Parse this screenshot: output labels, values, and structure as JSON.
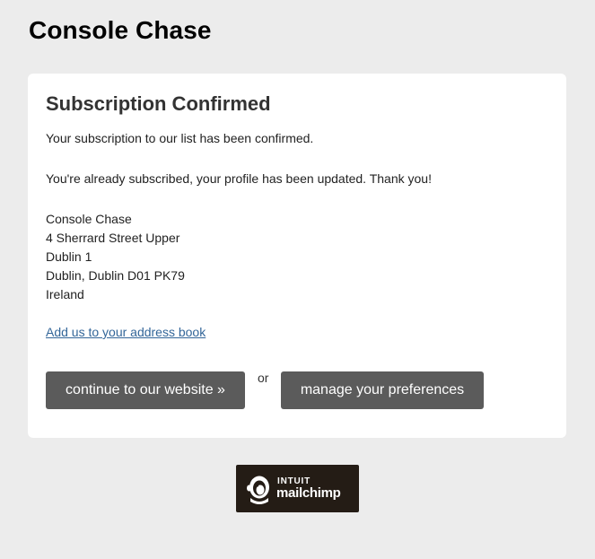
{
  "site": {
    "title": "Console Chase"
  },
  "confirmation": {
    "heading": "Subscription Confirmed",
    "message": "Your subscription to our list has been confirmed.",
    "detail": "You're already subscribed, your profile has been updated. Thank you!"
  },
  "address": {
    "lines": [
      "Console Chase",
      "4 Sherrard Street Upper",
      "Dublin 1",
      "Dublin, Dublin D01 PK79",
      "Ireland"
    ]
  },
  "links": {
    "address_book": "Add us to your address book"
  },
  "actions": {
    "continue_label": "continue to our website »",
    "separator": "or",
    "preferences_label": "manage your preferences"
  },
  "footer_badge": {
    "line1": "INTUIT",
    "line2": "mailchimp",
    "icon": "mailchimp-freddie-icon"
  },
  "colors": {
    "background": "#ececec",
    "card": "#ffffff",
    "button": "#5b5b5b",
    "link": "#336699",
    "badge": "#241c15"
  }
}
